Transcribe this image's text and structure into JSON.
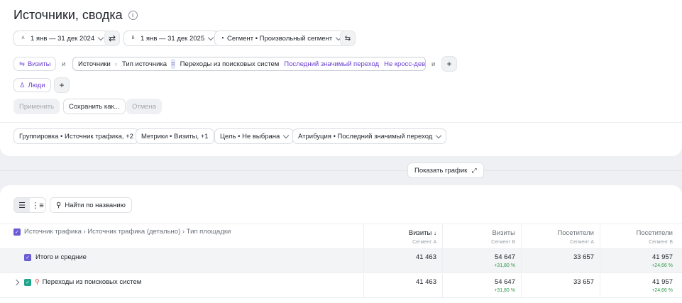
{
  "page": {
    "title": "Источники, сводка"
  },
  "period": {
    "a_badge": "A",
    "a_label": "1 янв — 31 дек 2024",
    "b_badge": "B",
    "b_label": "1 янв — 31 дек 2025",
    "segment_label": "Сегмент • Произвольный сегмент"
  },
  "filters": {
    "visits_chip": "Визиты",
    "and_1": "и",
    "and_2": "и",
    "crumb_1": "Источники",
    "crumb_sep": "›",
    "crumb_2": "Тип источника",
    "eq": "=",
    "value": "Переходы из поисковых систем",
    "attribution": "Последний значимый переход",
    "device": "Не кросс-девайс",
    "people_chip": "Люди"
  },
  "actions": {
    "apply": "Применить",
    "save_as": "Сохранить как...",
    "cancel": "Отмена"
  },
  "settings": {
    "grouping": "Группировка • Источник трафика, +2",
    "metrics": "Метрики • Визиты, +1",
    "goal": "Цель • Не выбрана",
    "attribution": "Атрибуция • Последний значимый переход"
  },
  "chart_toggle": {
    "label": "Показать график"
  },
  "table_toolbar": {
    "search_label": "Найти по названию"
  },
  "table": {
    "dimension_header": "Источник трафика › Источник трафика (детально) › Тип площадки",
    "columns": [
      {
        "label": "Визиты",
        "sub": "Сегмент A",
        "sort": "↓"
      },
      {
        "label": "Визиты",
        "sub": "Сегмент B",
        "sort": ""
      },
      {
        "label": "Посетители",
        "sub": "Сегмент A",
        "sort": ""
      },
      {
        "label": "Посетители",
        "sub": "Сегмент B",
        "sort": ""
      }
    ],
    "total": {
      "label": "Итого и средние",
      "v1": "41 463",
      "v2": "54 647",
      "d2": "+31,80 %",
      "v3": "33 657",
      "v4": "41 957",
      "d4": "+24,66 %"
    },
    "rows": [
      {
        "label": "Переходы из поисковых систем",
        "v1": "41 463",
        "v2": "54 647",
        "d2": "+31,80 %",
        "v3": "33 657",
        "v4": "41 957",
        "d4": "+24,66 %"
      }
    ]
  }
}
